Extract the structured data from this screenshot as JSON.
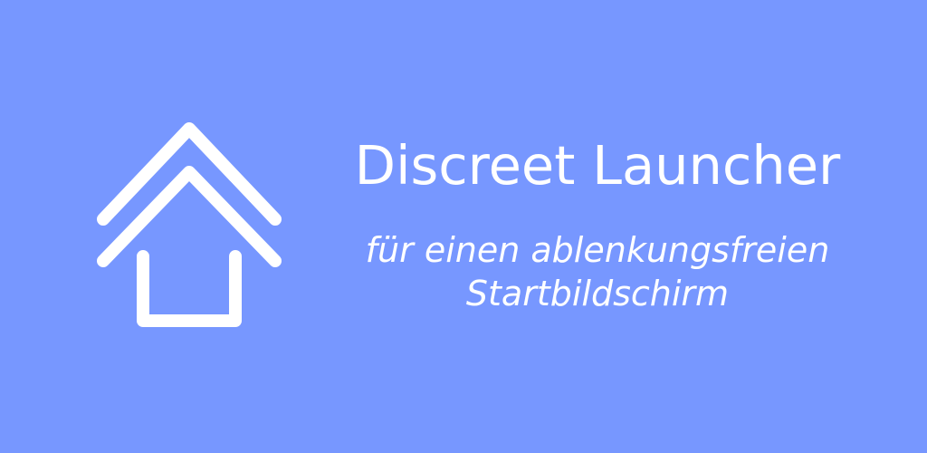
{
  "app": {
    "title": "Discreet Launcher",
    "subtitle_line1": "für einen ablenkungsfreien",
    "subtitle_line2": "Startbildschirm"
  },
  "logo": {
    "icon": "home-icon"
  },
  "colors": {
    "background": "#7797ff",
    "foreground": "#ffffff"
  }
}
